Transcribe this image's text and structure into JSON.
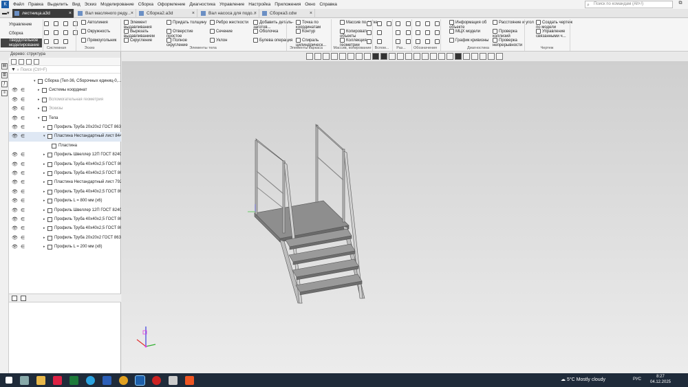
{
  "menu": [
    "Файл",
    "Правка",
    "Выделить",
    "Вид",
    "Эскиз",
    "Моделирование",
    "Сборка",
    "Оформление",
    "Диагностика",
    "Управление",
    "Настройка",
    "Приложения",
    "Окно",
    "Справка"
  ],
  "search_placeholder": "Поиск по командам (Alt+/)",
  "tabs": [
    {
      "label": "лестница.a3d",
      "active": true
    },
    {
      "label": "Вал масляного реду...",
      "active": false
    },
    {
      "label": "Сборка2.a3d",
      "active": false
    },
    {
      "label": "Вал насоса для подо...",
      "active": false
    },
    {
      "label": "Сборка3.cdw",
      "active": false
    }
  ],
  "left_tabs": [
    "Управление",
    "Сборка",
    "Твердотельное моделирование"
  ],
  "ribbon": {
    "col1": [
      "Автолиния",
      "Окружность",
      "Прямоугольник"
    ],
    "col2": [
      "Элемент выдавливания",
      "Вырезать выдавливанием",
      "Скругление"
    ],
    "col3": [
      "Придать толщину",
      "Отверстие простое",
      "Полное скругление"
    ],
    "col4": [
      "Ребро жесткости",
      "Сечение",
      "Уклон"
    ],
    "col5": [
      "Добавить деталь-заготов...",
      "Оболочка",
      "Булева операция"
    ],
    "col6": [
      "Точка по координатам",
      "Контур",
      "Спираль цилиндрическ..."
    ],
    "col7": [
      "Массив по сетке",
      "Копировать объекты",
      "Коллекция геометрии"
    ],
    "col8": [
      "Информация об объекте",
      "МЦХ модели",
      "График кривизны"
    ],
    "col9": [
      "Расстояние и угол",
      "Проверка коллизий",
      "Проверка непрерывности"
    ],
    "col10": [
      "Создать чертеж по модели",
      "Управление связанными ч..."
    ],
    "groups": [
      "Системная",
      "Эскиз",
      "Элементы тела",
      "Элементы каркаса",
      "Массив, копирование",
      "Вспом...",
      "Раз...",
      "Обозначения",
      "Диагностика",
      "Чертеж"
    ]
  },
  "tree": {
    "title": "Дерево: структура",
    "search": "Поиск (Ctrl+F)",
    "rows": [
      {
        "label": "Сборка (Тел-36, Сборочных единиц-0,...",
        "lvl": 0,
        "eye": false,
        "sel": false,
        "grey": false
      },
      {
        "label": "Системы координат",
        "lvl": 1,
        "eye": true,
        "sel": false,
        "grey": false
      },
      {
        "label": "Вспомогательная геометрия",
        "lvl": 1,
        "eye": true,
        "sel": false,
        "grey": true
      },
      {
        "label": "Эскизы",
        "lvl": 1,
        "eye": true,
        "sel": false,
        "grey": true
      },
      {
        "label": "Тела",
        "lvl": 1,
        "eye": true,
        "sel": false,
        "grey": false
      },
      {
        "label": "Профиль Труба  20x20x2 ГОСТ 8639-",
        "lvl": 2,
        "eye": true,
        "sel": false,
        "grey": false
      },
      {
        "label": "Пластина Нестандартный лист 844 x",
        "lvl": 2,
        "eye": true,
        "sel": true,
        "grey": false
      },
      {
        "label": "Пластина",
        "lvl": 3,
        "eye": false,
        "sel": false,
        "grey": false
      },
      {
        "label": "Профиль Швеллер  12П ГОСТ 8240-",
        "lvl": 2,
        "eye": true,
        "sel": false,
        "grey": false
      },
      {
        "label": "Профиль Труба  40x40x2,5 ГОСТ 863",
        "lvl": 2,
        "eye": true,
        "sel": false,
        "grey": false
      },
      {
        "label": "Профиль Труба  40x40x2,5 ГОСТ 863",
        "lvl": 2,
        "eye": true,
        "sel": false,
        "grey": false
      },
      {
        "label": "Пластина Нестандартный лист 792 x",
        "lvl": 2,
        "eye": true,
        "sel": false,
        "grey": false
      },
      {
        "label": "Профиль Труба  40x40x2,5 ГОСТ 863",
        "lvl": 2,
        "eye": true,
        "sel": false,
        "grey": false
      },
      {
        "label": "Профиль L = 800 мм (x6)",
        "lvl": 2,
        "eye": true,
        "sel": false,
        "grey": false
      },
      {
        "label": "Профиль Швеллер  12П ГОСТ 8240-",
        "lvl": 2,
        "eye": true,
        "sel": false,
        "grey": false
      },
      {
        "label": "Профиль Труба  40x40x2,5 ГОСТ 863",
        "lvl": 2,
        "eye": true,
        "sel": false,
        "grey": false
      },
      {
        "label": "Профиль Труба  40x40x2,5 ГОСТ 863",
        "lvl": 2,
        "eye": true,
        "sel": false,
        "grey": false
      },
      {
        "label": "Профиль Труба  20x20x2 ГОСТ 8639",
        "lvl": 2,
        "eye": true,
        "sel": false,
        "grey": false
      },
      {
        "label": "Профиль L = 200 мм (x8)",
        "lvl": 2,
        "eye": true,
        "sel": false,
        "grey": false
      }
    ]
  },
  "taskbar": {
    "weather": "5°C  Mostly cloudy",
    "lang": "РУС",
    "time": "8:27",
    "date": "04.12.2025"
  },
  "colors": {
    "accent": "#1d5ea8",
    "taskbar": "#1f2b3a"
  }
}
